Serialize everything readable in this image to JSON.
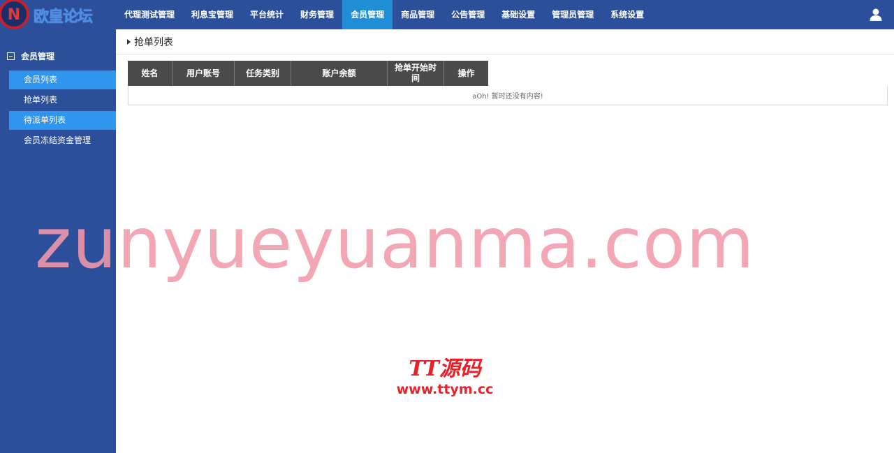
{
  "app": {
    "logo_text": "欧皇论坛",
    "logo_letter": "N"
  },
  "nav": {
    "items": [
      {
        "label": "代理测试管理",
        "active": false
      },
      {
        "label": "利息宝管理",
        "active": false
      },
      {
        "label": "平台统计",
        "active": false
      },
      {
        "label": "财务管理",
        "active": false
      },
      {
        "label": "会员管理",
        "active": true
      },
      {
        "label": "商品管理",
        "active": false
      },
      {
        "label": "公告管理",
        "active": false
      },
      {
        "label": "基础设置",
        "active": false
      },
      {
        "label": "管理员管理",
        "active": false
      },
      {
        "label": "系统设置",
        "active": false
      }
    ],
    "user_icon": "user-icon"
  },
  "sidebar": {
    "group_title": "会员管理",
    "group_icon": "collapse-minus-icon",
    "items": [
      {
        "label": "会员列表"
      },
      {
        "label": "抢单列表"
      },
      {
        "label": "待派单列表"
      },
      {
        "label": "会员冻结资金管理"
      }
    ]
  },
  "main": {
    "breadcrumb": "抢单列表",
    "table": {
      "headers": [
        "姓名",
        "用户账号",
        "任务类别",
        "账户余额",
        "抢单开始时间",
        "操作"
      ],
      "empty_text": "aOh! 暂时还没有内容!"
    }
  },
  "watermarks": {
    "big": "zunyueyuanma.com",
    "logo_title": "TT源码",
    "logo_url": "www.ttym.cc"
  },
  "colors": {
    "bar_bg": "#2b4f9a",
    "active_nav": "#1f8ed6",
    "sidebar_highlight": "#2f95ef",
    "header_bg": "#4a4a4a",
    "watermark_pink": "#f29aaa",
    "watermark_red": "#e8202a"
  }
}
